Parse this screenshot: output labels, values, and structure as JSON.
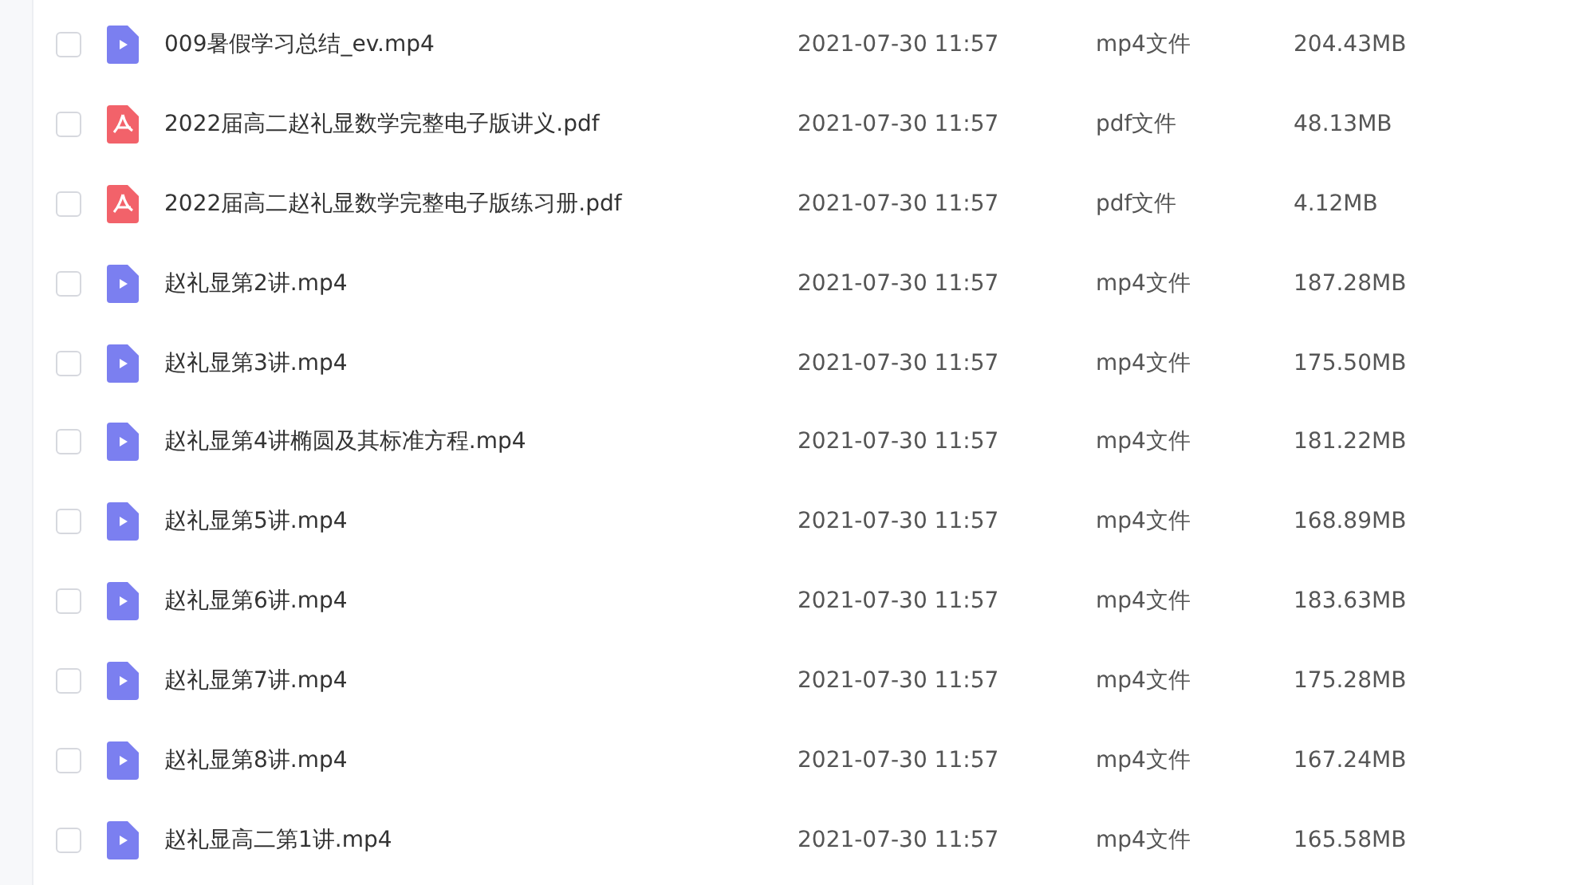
{
  "files": [
    {
      "name": "009暑假学习总结_ev.mp4",
      "kind": "video",
      "checked": false,
      "modified": "2021-07-30 11:57",
      "type": "mp4文件",
      "size": "204.43MB"
    },
    {
      "name": "2022届高二赵礼显数学完整电子版讲义.pdf",
      "kind": "pdf",
      "checked": false,
      "modified": "2021-07-30 11:57",
      "type": "pdf文件",
      "size": "48.13MB"
    },
    {
      "name": "2022届高二赵礼显数学完整电子版练习册.pdf",
      "kind": "pdf",
      "checked": false,
      "modified": "2021-07-30 11:57",
      "type": "pdf文件",
      "size": "4.12MB"
    },
    {
      "name": "赵礼显第2讲.mp4",
      "kind": "video",
      "checked": false,
      "modified": "2021-07-30 11:57",
      "type": "mp4文件",
      "size": "187.28MB"
    },
    {
      "name": "赵礼显第3讲.mp4",
      "kind": "video",
      "checked": false,
      "modified": "2021-07-30 11:57",
      "type": "mp4文件",
      "size": "175.50MB"
    },
    {
      "name": "赵礼显第4讲椭圆及其标准方程.mp4",
      "kind": "video",
      "checked": false,
      "modified": "2021-07-30 11:57",
      "type": "mp4文件",
      "size": "181.22MB"
    },
    {
      "name": "赵礼显第5讲.mp4",
      "kind": "video",
      "checked": false,
      "modified": "2021-07-30 11:57",
      "type": "mp4文件",
      "size": "168.89MB"
    },
    {
      "name": "赵礼显第6讲.mp4",
      "kind": "video",
      "checked": false,
      "modified": "2021-07-30 11:57",
      "type": "mp4文件",
      "size": "183.63MB"
    },
    {
      "name": "赵礼显第7讲.mp4",
      "kind": "video",
      "checked": false,
      "modified": "2021-07-30 11:57",
      "type": "mp4文件",
      "size": "175.28MB"
    },
    {
      "name": "赵礼显第8讲.mp4",
      "kind": "video",
      "checked": false,
      "modified": "2021-07-30 11:57",
      "type": "mp4文件",
      "size": "167.24MB"
    },
    {
      "name": "赵礼显高二第1讲.mp4",
      "kind": "video",
      "checked": false,
      "modified": "2021-07-30 11:57",
      "type": "mp4文件",
      "size": "165.58MB"
    }
  ]
}
